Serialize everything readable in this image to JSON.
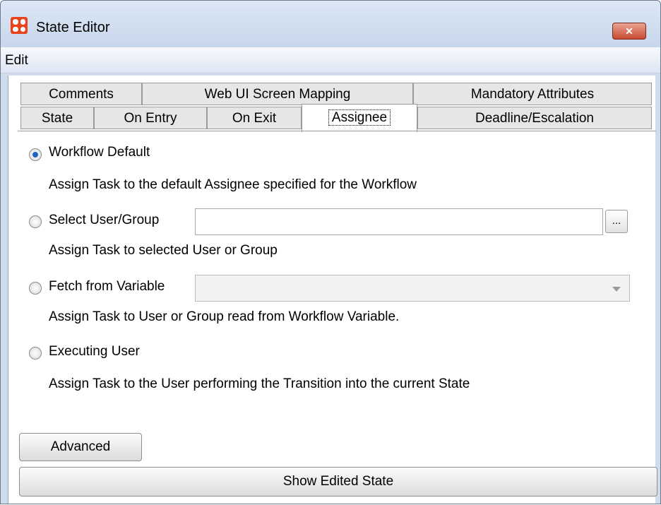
{
  "window": {
    "title": "State Editor",
    "close_glyph": "✕"
  },
  "menu": {
    "edit": "Edit"
  },
  "tabs": {
    "row_top": [
      "Comments",
      "Web UI Screen Mapping",
      "Mandatory Attributes"
    ],
    "row_bottom": [
      "State",
      "On Entry",
      "On Exit",
      "Assignee",
      "Deadline/Escalation"
    ],
    "active": "Assignee"
  },
  "options": [
    {
      "label": "Workflow Default",
      "description": "Assign Task to the default Assignee specified for the Workflow",
      "selected": true
    },
    {
      "label": "Select User/Group",
      "description": "Assign Task to selected User or Group",
      "selected": false
    },
    {
      "label": "Fetch from Variable",
      "description": "Assign Task to User or Group read from Workflow Variable.",
      "selected": false
    },
    {
      "label": "Executing User",
      "description": "Assign Task to the User performing the Transition into the current State",
      "selected": false
    }
  ],
  "user_group_field": {
    "value": ""
  },
  "browse_button": "...",
  "variable_select": {
    "value": ""
  },
  "buttons": {
    "advanced": "Advanced",
    "show_edited_state": "Show Edited State"
  },
  "icons": {
    "app": "app-logo-icon",
    "close": "close-icon",
    "dropdown": "chevron-down-icon"
  },
  "colors": {
    "accent_radio": "#1f64c4",
    "close_button": "#c94a30",
    "app_icon": "#e8421b"
  }
}
